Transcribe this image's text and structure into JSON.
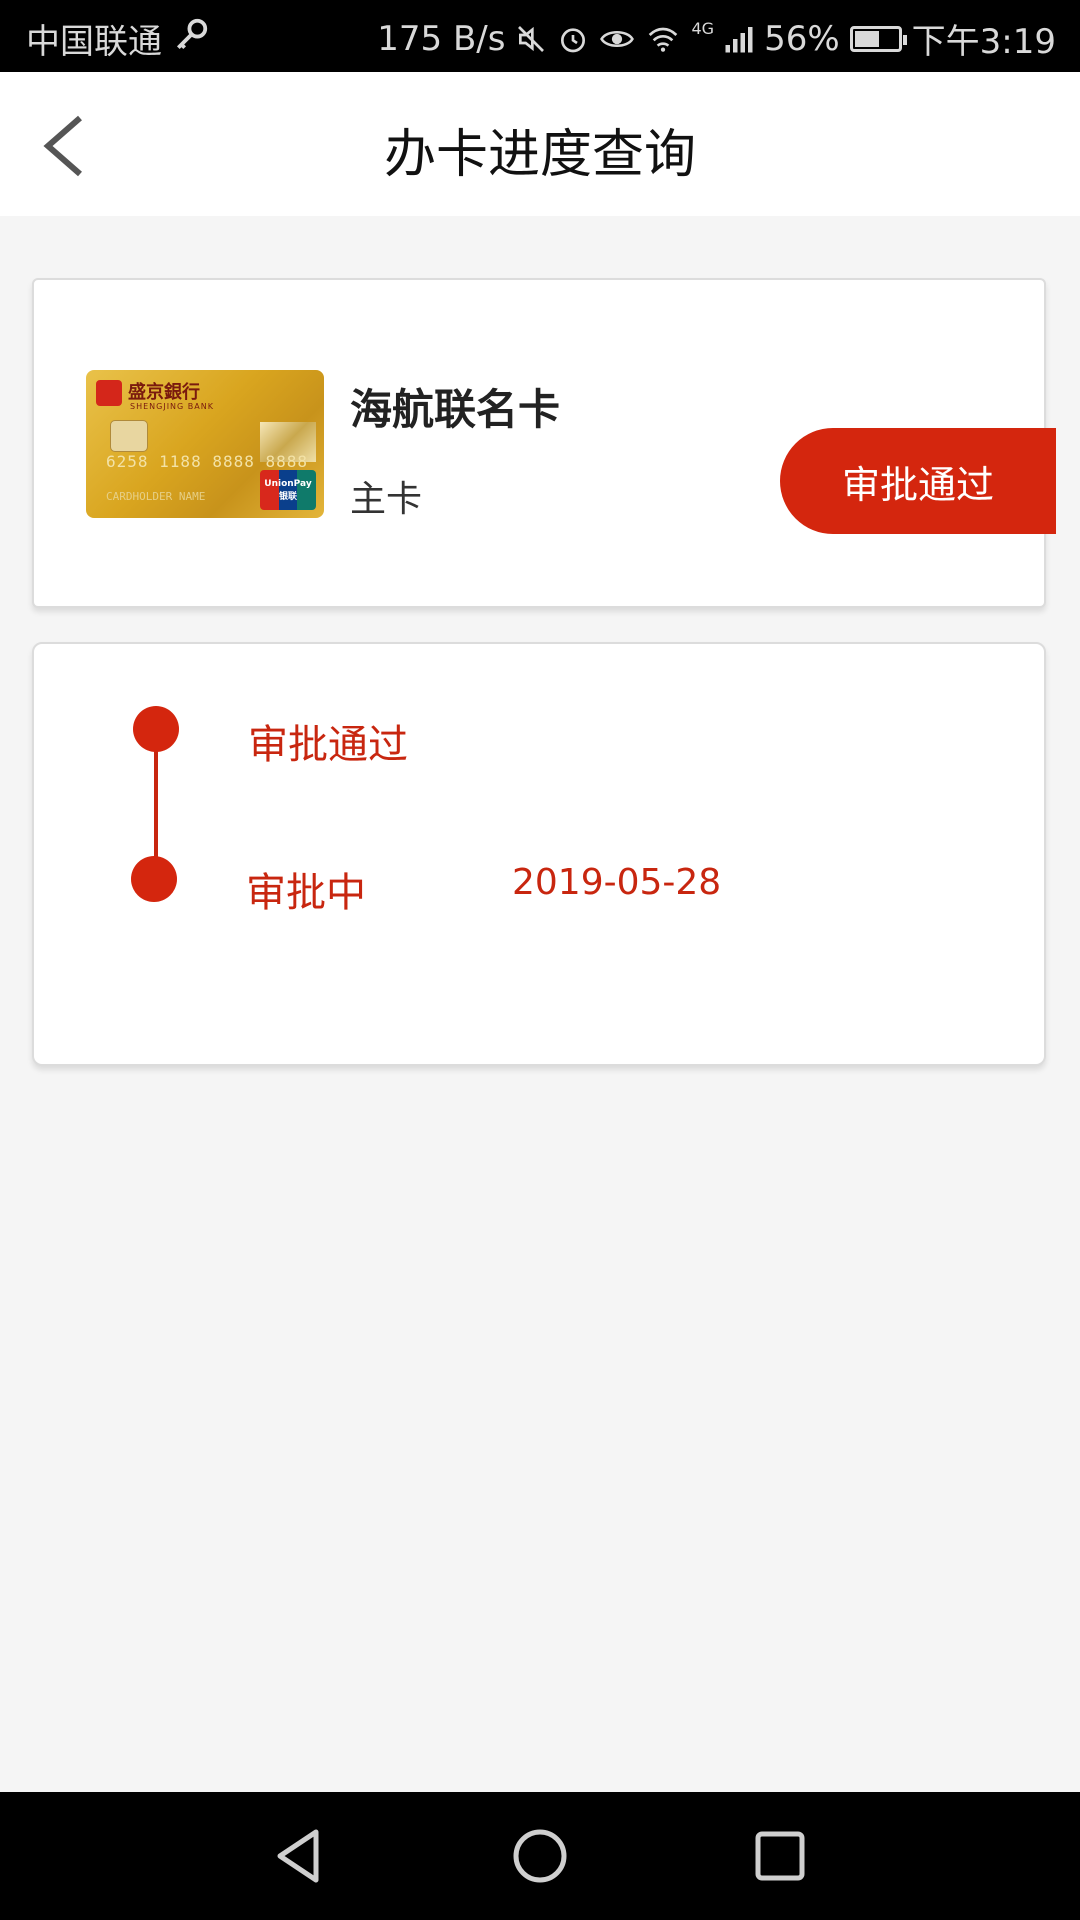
{
  "status_bar": {
    "carrier": "中国联通",
    "net_speed": "175 B/s",
    "network": "4G",
    "battery": "56%",
    "battery_level": 0.56,
    "time": "下午3:19"
  },
  "header": {
    "title": "办卡进度查询"
  },
  "card": {
    "name": "海航联名卡",
    "type": "主卡",
    "status": "审批通过",
    "image": {
      "bank_name": "盛京銀行",
      "bank_name_en": "SHENGJING BANK",
      "number": "6258 1188 8888 8888",
      "holder": "CARDHOLDER NAME",
      "network": "UnionPay 银联"
    }
  },
  "progress": {
    "steps": [
      {
        "label": "审批通过",
        "date": ""
      },
      {
        "label": "审批中",
        "date": "2019-05-28"
      }
    ]
  },
  "colors": {
    "accent": "#d4260e",
    "background": "#f5f5f5"
  }
}
